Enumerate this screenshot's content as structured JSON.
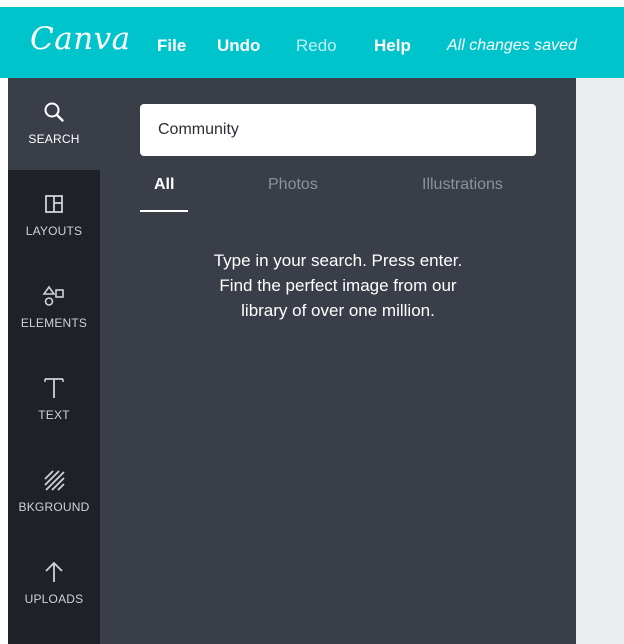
{
  "header": {
    "logo": "Canva",
    "menu": [
      {
        "label": "File"
      },
      {
        "label": "Undo"
      },
      {
        "label": "Redo"
      },
      {
        "label": "Help"
      }
    ],
    "status": "All changes saved"
  },
  "sidebar": {
    "items": [
      {
        "label": "SEARCH",
        "icon": "search-icon",
        "active": true
      },
      {
        "label": "LAYOUTS",
        "icon": "layout-icon"
      },
      {
        "label": "ELEMENTS",
        "icon": "shapes-icon"
      },
      {
        "label": "TEXT",
        "icon": "text-icon"
      },
      {
        "label": "BKGROUND",
        "icon": "background-icon"
      },
      {
        "label": "UPLOADS",
        "icon": "upload-icon"
      }
    ]
  },
  "panel": {
    "search": {
      "value": "Community"
    },
    "tabs": [
      {
        "label": "All",
        "active": true
      },
      {
        "label": "Photos"
      },
      {
        "label": "Illustrations"
      }
    ],
    "message": [
      "Type in your search. Press enter.",
      "Find the perfect image from our",
      "library of over one million."
    ]
  },
  "colors": {
    "topbar": "#00c4cc",
    "rail": "#1e2127",
    "panel": "#3a3e48",
    "canvas": "#ebecee"
  }
}
